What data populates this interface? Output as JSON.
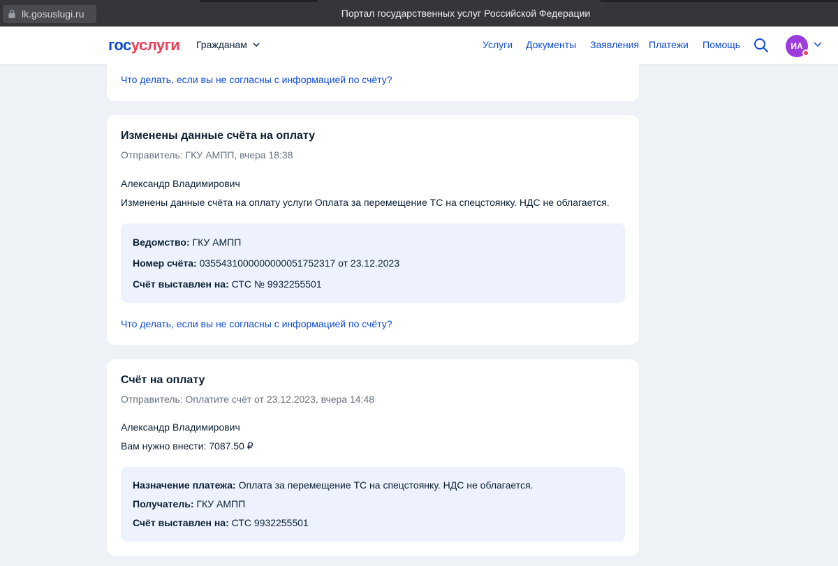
{
  "browser": {
    "url": "lk.gosuslugi.ru",
    "window_title": "Портал государственных услуг Российской Федерации"
  },
  "header": {
    "logo_part1": "гос",
    "logo_part2": "услуги",
    "audience": "Гражданам",
    "nav": [
      "Услуги",
      "Документы",
      "Заявления",
      "Платежи",
      "Помощь"
    ],
    "avatar_initials": "ИА",
    "colors": {
      "brand_blue": "#0d4cd3",
      "brand_red": "#ee3f58",
      "avatar": "#9b3cdb"
    }
  },
  "top_card": {
    "link": "Что делать, если вы не согласны с информацией по счёту?"
  },
  "card1": {
    "title": "Изменены данные счёта на оплату",
    "sender": "Отправитель: ГКУ АМПП, вчера 18:38",
    "greeting": "Александр Владимирович",
    "message": "Изменены данные счёта на оплату услуги Оплата за перемещение ТС на спецстоянку. НДС не облагается.",
    "rows": [
      {
        "label": "Ведомство:",
        "value": "ГКУ АМПП"
      },
      {
        "label": "Номер счёта:",
        "value": "0355431000000000051752317 от 23.12.2023"
      },
      {
        "label": "Счёт выставлен на:",
        "value": "СТС № 9932255501"
      }
    ],
    "link": "Что делать, если вы не согласны с информацией по счёту?"
  },
  "card2": {
    "title": "Счёт на оплату",
    "sender": "Отправитель: Оплатите счёт от 23.12.2023, вчера 14:48",
    "greeting": "Александр Владимирович",
    "amount_text": "Вам нужно внести: 7087.50 ₽",
    "rows": [
      {
        "label": "Назначение платежа:",
        "value": "Оплата за перемещение ТС на спецстоянку. НДС не облагается."
      },
      {
        "label": "Получатель:",
        "value": "ГКУ АМПП"
      },
      {
        "label": "Счёт выставлен на:",
        "value": "СТС 9932255501"
      }
    ]
  }
}
